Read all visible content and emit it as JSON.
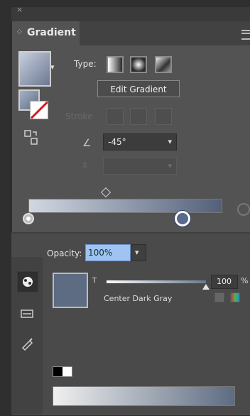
{
  "panel": {
    "title": "Gradient",
    "close_glyph": "×",
    "menu_icon": "panel-menu-icon"
  },
  "gradient": {
    "type_label": "Type:",
    "type_buttons": [
      "linear-gradient-icon",
      "radial-gradient-icon",
      "freeform-gradient-icon"
    ],
    "edit_button": "Edit Gradient",
    "stroke_label": "Stroke",
    "angle_value": "-45°",
    "aspect_value": "",
    "colors": {
      "start": "#d2d8e2",
      "end": "#53607a"
    }
  },
  "color_picker": {
    "opacity_label": "Opacity:",
    "opacity_value": "100%",
    "tint_label": "T",
    "tint_value": "100",
    "tint_unit": "%",
    "color_name": "Center Dark Gray",
    "swatch_color": "#5d6c82"
  }
}
